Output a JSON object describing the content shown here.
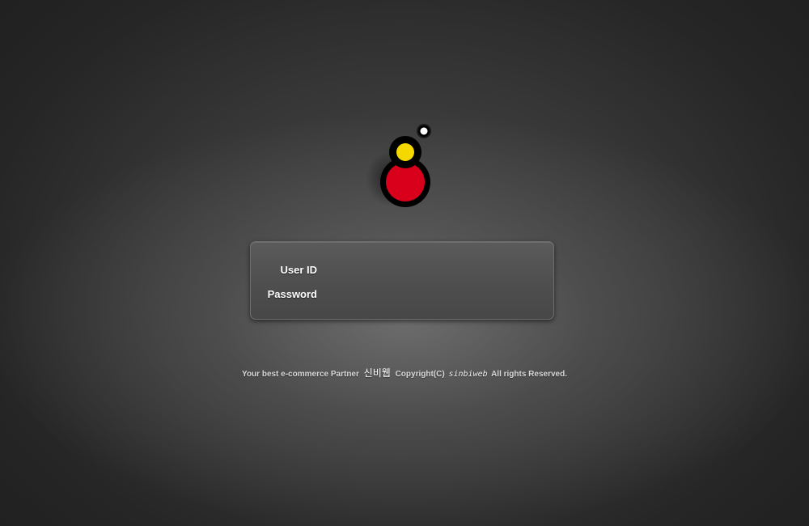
{
  "login": {
    "userid_label": "User ID",
    "password_label": "Password",
    "userid_value": "",
    "password_value": ""
  },
  "footer": {
    "prefix": "Your best e-commerce Partner",
    "brand_korean": "신비웹",
    "copyright": "Copyright(C)",
    "brand": "sinbiweb",
    "suffix": "All rights Reserved."
  },
  "logo": {
    "icon": "sinbiweb-logo-icon",
    "colors": {
      "outline": "#000000",
      "body": "#d9001b",
      "head": "#f5d800",
      "dot": "#ffffff"
    }
  },
  "theme": {
    "background": "#2b2b2b",
    "panel": "#545454",
    "text": "#ffffff"
  }
}
